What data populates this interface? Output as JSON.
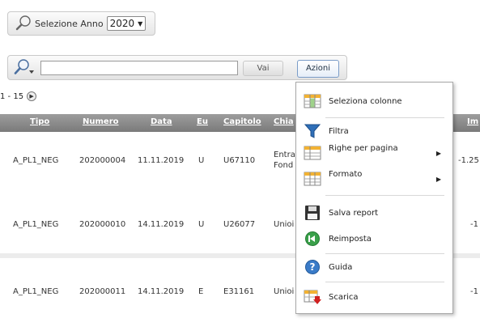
{
  "year_selector": {
    "label": "Selezione Anno",
    "value": "2020"
  },
  "search": {
    "placeholder": "",
    "go_label": "Vai",
    "actions_label": "Azioni"
  },
  "pagination": {
    "range": "1 - 15"
  },
  "table": {
    "headers": [
      "Tipo",
      "Numero",
      "Data",
      "Eu",
      "Capitolo",
      "Chia",
      "Im"
    ],
    "rows": [
      {
        "tipo": "A_PL1_NEG",
        "numero": "202000004",
        "data": "11.11.2019",
        "eu": "U",
        "capitolo": "U67110",
        "chiave": "Entra",
        "chiave2": "Fond",
        "importo": "-1.25"
      },
      {
        "tipo": "A_PL1_NEG",
        "numero": "202000010",
        "data": "14.11.2019",
        "eu": "U",
        "capitolo": "U26077",
        "chiave": "Unioi",
        "chiave2": "",
        "importo": "-1"
      },
      {
        "tipo": "A_PL1_NEG",
        "numero": "202000011",
        "data": "14.11.2019",
        "eu": "E",
        "capitolo": "E31161",
        "chiave": "Unioi",
        "chiave2": "",
        "importo": "-1"
      }
    ]
  },
  "menu": {
    "items": [
      {
        "label": "Seleziona colonne",
        "icon": "columns-icon"
      },
      {
        "label": "Filtra",
        "icon": "filter-icon"
      },
      {
        "label": "Righe per pagina",
        "icon": "rows-icon",
        "submenu": true
      },
      {
        "label": "Formato",
        "icon": "format-icon",
        "submenu": true
      },
      {
        "label": "Salva report",
        "icon": "save-icon"
      },
      {
        "label": "Reimposta",
        "icon": "reset-icon"
      },
      {
        "label": "Guida",
        "icon": "help-icon"
      },
      {
        "label": "Scarica",
        "icon": "download-icon"
      }
    ]
  },
  "colors": {
    "header_bg": "#8a8a8a",
    "accent_blue": "#3a7bc8",
    "filter_blue": "#2f6fb8",
    "reset_green": "#3aa04a"
  }
}
